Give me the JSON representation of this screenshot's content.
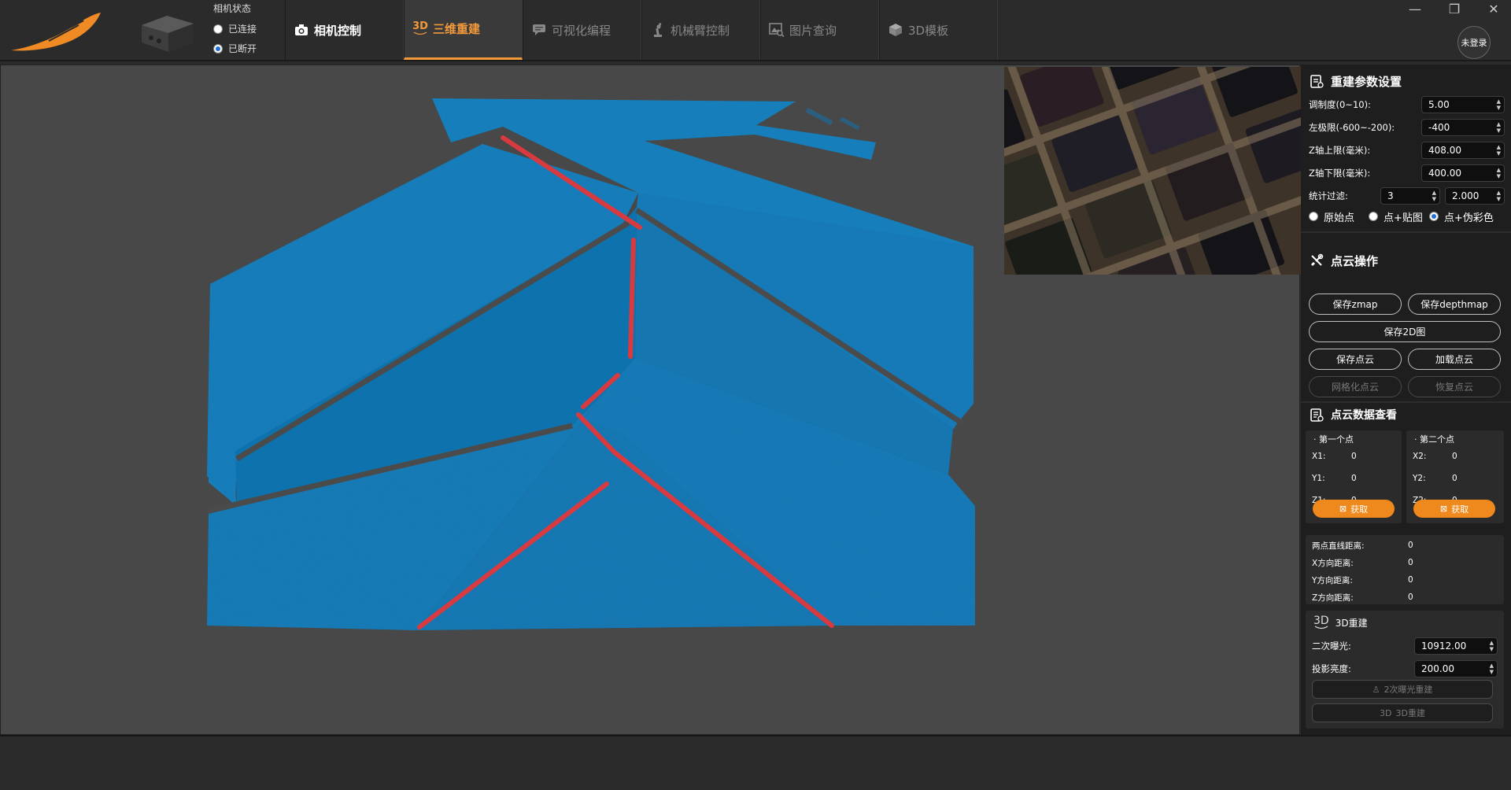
{
  "camera_status": {
    "title": "相机状态",
    "options": [
      {
        "label": "已连接",
        "selected": false
      },
      {
        "label": "已断开",
        "selected": true
      }
    ]
  },
  "tabs": [
    {
      "label": "相机控制",
      "icon": "camera-icon",
      "state": "normal"
    },
    {
      "label": "三维重建",
      "icon": "3d-icon",
      "icon_text": "3D",
      "state": "active"
    },
    {
      "label": "可视化编程",
      "icon": "chat-icon",
      "state": "disabled"
    },
    {
      "label": "机械臂控制",
      "icon": "robot-arm-icon",
      "state": "disabled"
    },
    {
      "label": "图片查询",
      "icon": "image-search-icon",
      "state": "disabled"
    },
    {
      "label": "3D模板",
      "icon": "cube-icon",
      "state": "disabled"
    }
  ],
  "window": {
    "minimize": "—",
    "restore": "❐",
    "close": "✕"
  },
  "login": {
    "label": "未登录"
  },
  "colors": {
    "accent": "#f39a3c",
    "cloud_blue": "#1a83c4",
    "edge_red": "#d93a3f"
  },
  "recon_params": {
    "title": "重建参数设置",
    "rows": [
      {
        "label": "调制度(0~10):",
        "value": "5.00"
      },
      {
        "label": "左极限(-600~-200):",
        "value": "-400"
      },
      {
        "label": "Z轴上限(毫米):",
        "value": "408.00"
      },
      {
        "label": "Z轴下限(毫米):",
        "value": "400.00"
      }
    ],
    "stat_filter": {
      "label": "统计过滤:",
      "value1": "3",
      "value2": "2.000"
    },
    "display_mode": [
      {
        "label": "原始点",
        "selected": false
      },
      {
        "label": "点+贴图",
        "selected": false
      },
      {
        "label": "点+伪彩色",
        "selected": true
      }
    ]
  },
  "cloud_ops": {
    "title": "点云操作",
    "save_zmap": "保存zmap",
    "save_depthmap": "保存depthmap",
    "save_2d": "保存2D图",
    "save_cloud": "保存点云",
    "load_cloud": "加载点云",
    "mesh_cloud": "网格化点云",
    "restore_cloud": "恢复点云"
  },
  "cloud_data": {
    "title": "点云数据查看",
    "first": {
      "title": "第一个点",
      "x_label": "X1:",
      "x": "0",
      "y_label": "Y1:",
      "y": "0",
      "z_label": "Z1:",
      "z": "0",
      "get": "获取"
    },
    "second": {
      "title": "第二个点",
      "x_label": "X2:",
      "x": "0",
      "y_label": "Y2:",
      "y": "0",
      "z_label": "Z2:",
      "z": "0",
      "get": "获取"
    },
    "distances": [
      {
        "label": "两点直线距离:",
        "value": "0"
      },
      {
        "label": "X方向距离:",
        "value": "0"
      },
      {
        "label": "Y方向距离:",
        "value": "0"
      },
      {
        "label": "Z方向距离:",
        "value": "0"
      }
    ]
  },
  "recon3d": {
    "title": "3D重建",
    "icon_text": "3D",
    "exposure": {
      "label": "二次曝光:",
      "value": "10912.00"
    },
    "brightness": {
      "label": "投影亮度:",
      "value": "200.00"
    },
    "btn_second": "2次曝光重建",
    "btn_3d": "3D重建",
    "btn_3d_icon": "3D"
  }
}
